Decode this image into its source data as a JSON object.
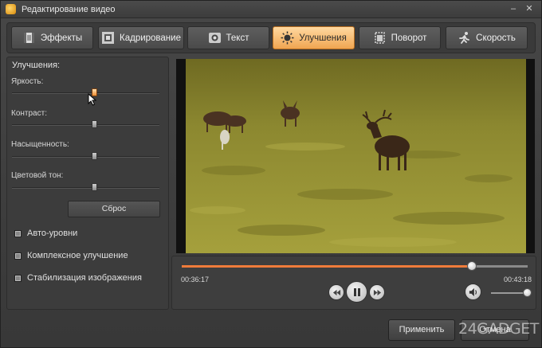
{
  "window": {
    "title": "Редактирование видео",
    "minimize_glyph": "–",
    "close_glyph": "✕"
  },
  "tabs": [
    {
      "label": "Эффекты",
      "icon": "film-effects-icon",
      "active": false
    },
    {
      "label": "Кадрирование",
      "icon": "crop-frame-icon",
      "active": false
    },
    {
      "label": "Текст",
      "icon": "text-icon",
      "active": false
    },
    {
      "label": "Улучшения",
      "icon": "sun-brightness-icon",
      "active": true
    },
    {
      "label": "Поворот",
      "icon": "rotate-icon",
      "active": false
    },
    {
      "label": "Скорость",
      "icon": "running-person-icon",
      "active": false
    }
  ],
  "enhancements": {
    "section_title": "Улучшения:",
    "sliders": [
      {
        "label": "Яркость:",
        "value": 0.56,
        "active": true
      },
      {
        "label": "Контраст:",
        "value": 0.56,
        "active": false
      },
      {
        "label": "Насыщенность:",
        "value": 0.56,
        "active": false
      },
      {
        "label": "Цветовой тон:",
        "value": 0.56,
        "active": false
      }
    ],
    "reset_label": "Сброс",
    "checkboxes": [
      {
        "label": "Авто-уровни",
        "checked": false
      },
      {
        "label": "Комплексное улучшение",
        "checked": false
      },
      {
        "label": "Стабилизация изображения",
        "checked": false
      }
    ]
  },
  "player": {
    "current_time": "00:36:17",
    "total_time": "00:43:18",
    "progress": 0.838,
    "volume": 1.0
  },
  "buttons": {
    "apply": "Применить",
    "cancel": "Отмена"
  },
  "watermark": "24GADGET",
  "colors": {
    "accent": "#ef7b3a",
    "active_tab": "#f0a552"
  }
}
